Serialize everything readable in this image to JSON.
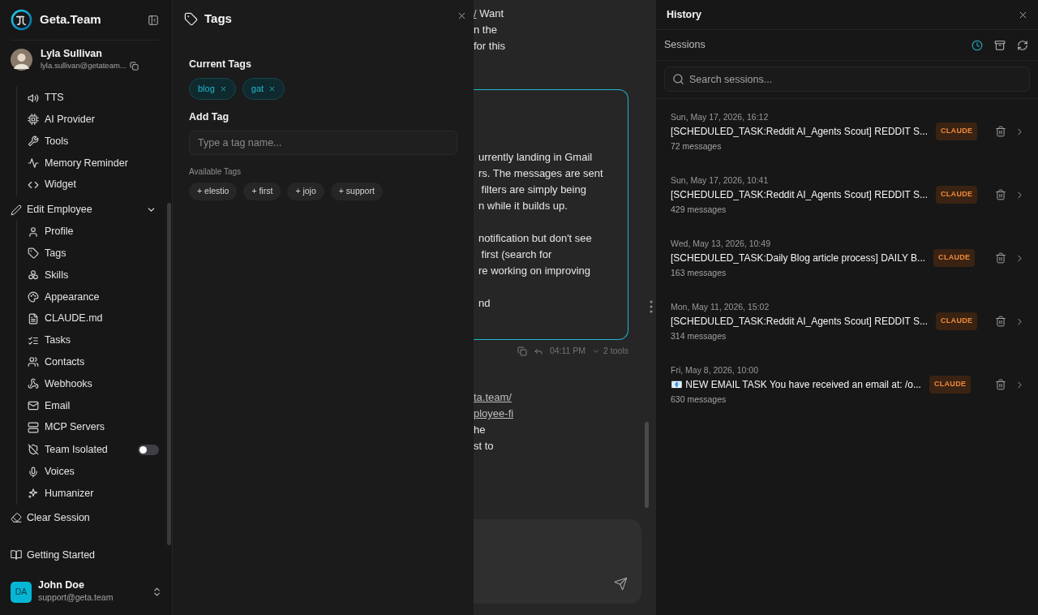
{
  "brand": {
    "name": "Geta.Team"
  },
  "employee": {
    "name": "Lyla Sullivan",
    "email": "lyla.sullivan@getateam..."
  },
  "sidebar": {
    "upper_items": [
      {
        "label": "TTS"
      },
      {
        "label": "AI Provider"
      },
      {
        "label": "Tools"
      },
      {
        "label": "Memory Reminder"
      },
      {
        "label": "Widget"
      }
    ],
    "section": {
      "label": "Edit Employee",
      "expanded": true,
      "children": [
        {
          "label": "Profile",
          "kind": "link"
        },
        {
          "label": "Tags",
          "kind": "link"
        },
        {
          "label": "Skills",
          "kind": "link"
        },
        {
          "label": "Appearance",
          "kind": "link"
        },
        {
          "label": "CLAUDE.md",
          "kind": "link"
        },
        {
          "label": "Tasks",
          "kind": "link"
        },
        {
          "label": "Contacts",
          "kind": "link"
        },
        {
          "label": "Webhooks",
          "kind": "link"
        },
        {
          "label": "Email",
          "kind": "link"
        },
        {
          "label": "MCP Servers",
          "kind": "link"
        },
        {
          "label": "Team Isolated",
          "kind": "toggle",
          "on": false
        },
        {
          "label": "Voices",
          "kind": "link"
        },
        {
          "label": "Humanizer",
          "kind": "link"
        }
      ]
    },
    "clear_session": "Clear Session",
    "getting_started": "Getting Started"
  },
  "user": {
    "initials": "DA",
    "name": "John Doe",
    "email": "support@geta.team"
  },
  "tags_panel": {
    "title": "Tags",
    "current_label": "Current Tags",
    "current_tags": [
      {
        "label": "blog"
      },
      {
        "label": "gat"
      }
    ],
    "add_label": "Add Tag",
    "placeholder": "Type a tag name...",
    "available_label": "Available Tags",
    "available_tags": [
      {
        "label": "+ elestio"
      },
      {
        "label": "+ first"
      },
      {
        "label": "+ jojo"
      },
      {
        "label": "+ support"
      }
    ]
  },
  "chat": {
    "lines_above": [
      [
        {
          "text": "/",
          "link": true
        },
        {
          "text": " Want",
          "link": false
        }
      ],
      [
        {
          "text": "n the",
          "link": false
        }
      ],
      [
        {
          "text": "for this",
          "link": false
        }
      ]
    ],
    "message": {
      "paragraphs": [
        [
          "urrently landing in Gmail",
          "rs. The messages are sent",
          " filters are simply being",
          "n while it builds up."
        ],
        [
          "notification but don't see",
          " first (search for",
          "re working on improving"
        ],
        [
          "nd"
        ]
      ]
    },
    "meta": {
      "time": "04:11 PM",
      "tools": "2 tools"
    },
    "lines_below": [
      [
        {
          "text": "ta.team/",
          "link": true
        }
      ],
      [
        {
          "text": "ployee-fi",
          "link": true
        }
      ],
      [
        {
          "text": "he",
          "link": false
        }
      ],
      [
        {
          "text": "st to",
          "link": false
        }
      ]
    ]
  },
  "history": {
    "title": "History",
    "sessions_label": "Sessions",
    "views": [
      {
        "selected": true
      },
      {
        "selected": false
      }
    ],
    "search_placeholder": "Search sessions...",
    "sessions": [
      {
        "date": "Sun, May 17, 2026, 16:12",
        "title": "[SCHEDULED_TASK:Reddit AI_Agents Scout] REDDIT S...",
        "badge": "CLAUDE",
        "count": "72 messages"
      },
      {
        "date": "Sun, May 17, 2026, 10:41",
        "title": "[SCHEDULED_TASK:Reddit AI_Agents Scout] REDDIT S...",
        "badge": "CLAUDE",
        "count": "429 messages"
      },
      {
        "date": "Wed, May 13, 2026, 10:49",
        "title": "[SCHEDULED_TASK:Daily Blog article process] DAILY B...",
        "badge": "CLAUDE",
        "count": "163 messages"
      },
      {
        "date": "Mon, May 11, 2026, 15:02",
        "title": "[SCHEDULED_TASK:Reddit AI_Agents Scout] REDDIT S...",
        "badge": "CLAUDE",
        "count": "314 messages"
      },
      {
        "date": "Fri, May 8, 2026, 10:00",
        "title": "📧 NEW EMAIL TASK You have received an email at: /o...",
        "badge": "CLAUDE",
        "count": "630 messages"
      }
    ]
  }
}
